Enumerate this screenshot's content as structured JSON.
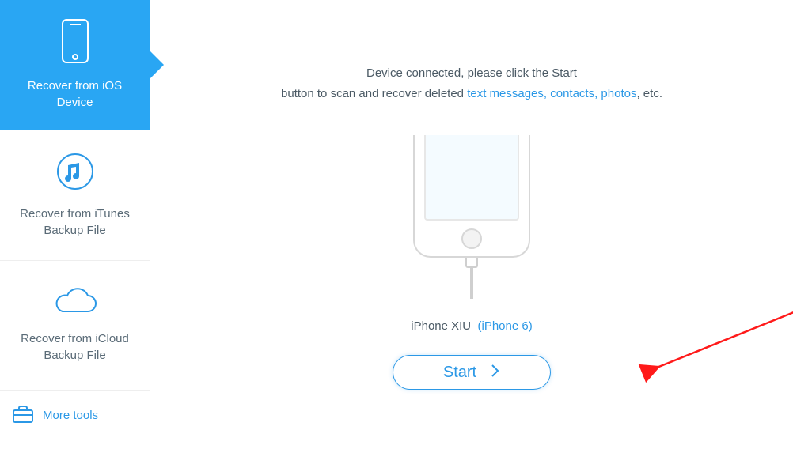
{
  "sidebar": {
    "items": [
      {
        "label": "Recover from iOS Device"
      },
      {
        "label": "Recover from iTunes Backup File"
      },
      {
        "label": "Recover from iCloud Backup File"
      }
    ],
    "moreTools": "More tools"
  },
  "main": {
    "intro_line1": "Device connected, please click the Start",
    "intro_line2_pre": "button to scan and recover deleted ",
    "intro_links": "text messages, contacts, photos",
    "intro_line2_post": ", etc.",
    "device_name": "iPhone XIU",
    "device_model": "(iPhone 6)",
    "start_label": "Start"
  }
}
